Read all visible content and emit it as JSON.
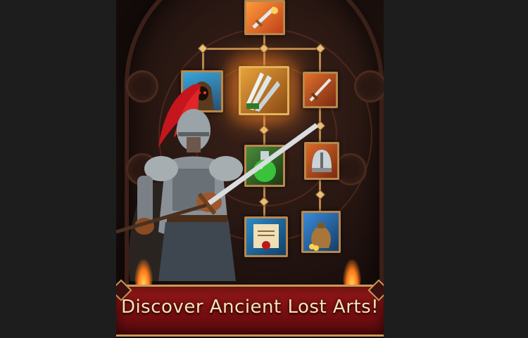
{
  "banner": {
    "text": "Discover Ancient Lost Arts!"
  },
  "skill_tree": {
    "tiles": [
      {
        "name": "flaming-sword-skill",
        "icon": "flaming-sword-icon",
        "state": "unlocked"
      },
      {
        "name": "hooded-assassin-skill",
        "icon": "hooded-figure-icon",
        "state": "unlocked"
      },
      {
        "name": "triple-blade-skill",
        "icon": "triple-blade-icon",
        "state": "featured"
      },
      {
        "name": "fire-blade-skill",
        "icon": "fire-blade-icon",
        "state": "unlocked"
      },
      {
        "name": "poison-flask-skill",
        "icon": "green-flask-icon",
        "state": "unlocked"
      },
      {
        "name": "helmet-skill",
        "icon": "helmet-icon",
        "state": "unlocked"
      },
      {
        "name": "scroll-skill",
        "icon": "sealed-scroll-icon",
        "state": "unlocked"
      },
      {
        "name": "gold-sack-skill",
        "icon": "gold-sack-icon",
        "state": "unlocked"
      }
    ]
  },
  "colors": {
    "frame_gold": "#b9874b",
    "banner_red": "#8a1416",
    "banner_text": "#f5e3b8",
    "page_bg": "#1d1d1d"
  }
}
